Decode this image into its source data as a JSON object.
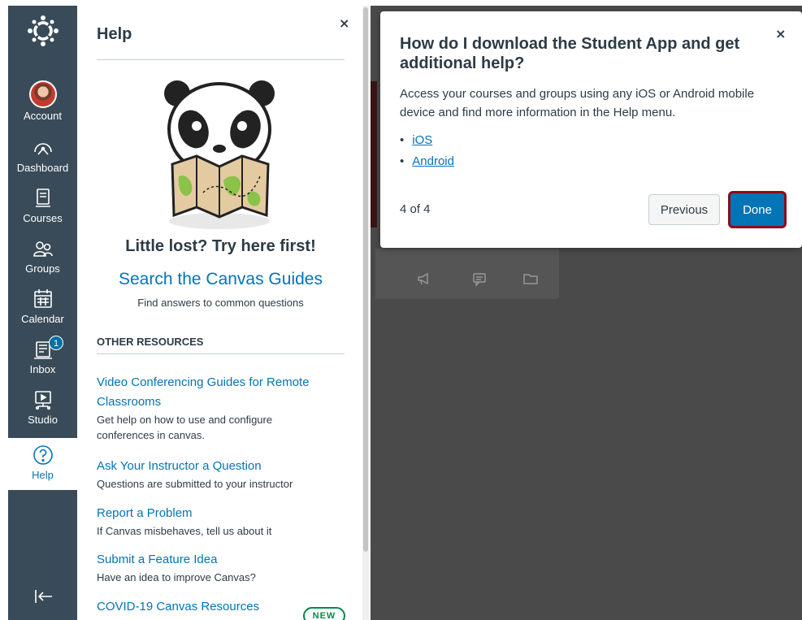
{
  "global_nav": {
    "logo_icon": "canvas-logo-icon",
    "items": [
      {
        "label": "Account",
        "icon": "avatar"
      },
      {
        "label": "Dashboard",
        "icon": "dashboard-icon"
      },
      {
        "label": "Courses",
        "icon": "courses-icon"
      },
      {
        "label": "Groups",
        "icon": "groups-icon"
      },
      {
        "label": "Calendar",
        "icon": "calendar-icon"
      },
      {
        "label": "Inbox",
        "icon": "inbox-icon",
        "badge": "1"
      },
      {
        "label": "Studio",
        "icon": "studio-icon"
      },
      {
        "label": "Help",
        "icon": "help-icon",
        "active": true
      }
    ],
    "collapse_icon": "collapse-nav-icon"
  },
  "help_tray": {
    "title": "Help",
    "close": "×",
    "illustration": "panda-with-map",
    "lost_heading": "Little lost? Try here first!",
    "guides_link": "Search the Canvas Guides",
    "guides_desc": "Find answers to common questions",
    "other_heading": "OTHER RESOURCES",
    "resources": [
      {
        "link": "Video Conferencing Guides for Remote Classrooms",
        "desc": "Get help on how to use and configure conferences in canvas."
      },
      {
        "link": "Ask Your Instructor a Question",
        "desc": "Questions are submitted to your instructor"
      },
      {
        "link": "Report a Problem",
        "desc": "If Canvas misbehaves, tell us about it"
      },
      {
        "link": "Submit a Feature Idea",
        "desc": "Have an idea to improve Canvas?"
      },
      {
        "link": "COVID-19 Canvas Resources",
        "badge": "NEW"
      }
    ]
  },
  "popover": {
    "title": "How do I download the Student App and get additional help?",
    "close": "×",
    "body": "Access your courses and groups using any iOS or Android mobile device and find more information in the Help menu.",
    "links": [
      "iOS",
      "Android"
    ],
    "step": "4 of 4",
    "previous_label": "Previous",
    "done_label": "Done"
  },
  "colors": {
    "nav_bg": "#394b58",
    "link": "#0374b5",
    "text": "#2d3b45",
    "done_focus": "#8b0a1a",
    "new_badge": "#0b874b"
  }
}
